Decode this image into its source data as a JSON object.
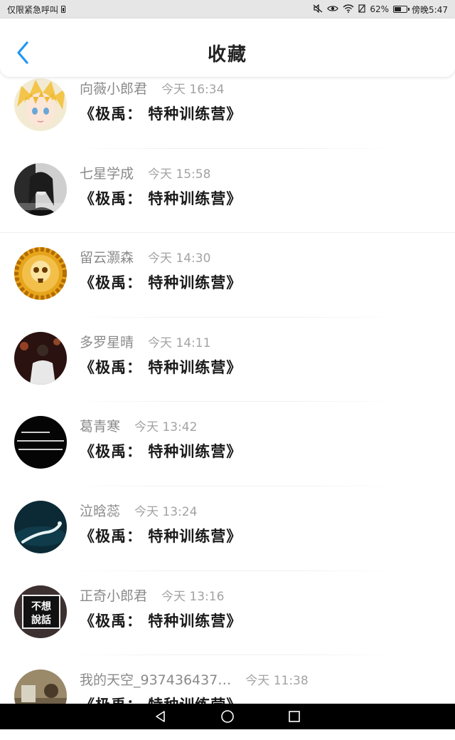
{
  "status_bar": {
    "carrier": "仅限紧急呼叫",
    "battery_percent": "62%",
    "time": "傍晚5:47",
    "battery_level": 0.62
  },
  "header": {
    "title": "收藏",
    "back_icon": "chevron-left-icon",
    "accent_color": "#2196f3"
  },
  "favorites": [
    {
      "user": "向薇小郎君",
      "time": "今天 16:34",
      "title": "《极禹： 特种训练营》",
      "avatar": "anime-blonde"
    },
    {
      "user": "七星学成",
      "time": "今天 15:58",
      "title": "《极禹： 特种训练营》",
      "avatar": "bw-girl"
    },
    {
      "user": "留云灏森",
      "time": "今天 14:30",
      "title": "《极禹： 特种训练营》",
      "avatar": "gold-skull"
    },
    {
      "user": "多罗星晴",
      "time": "今天 14:11",
      "title": "《极禹： 特种训练营》",
      "avatar": "night-person"
    },
    {
      "user": "葛青寒",
      "time": "今天 13:42",
      "title": "《极禹： 特种训练营》",
      "avatar": "black-text"
    },
    {
      "user": "泣晗蕊",
      "time": "今天 13:24",
      "title": "《极禹： 特种训练营》",
      "avatar": "underwater"
    },
    {
      "user": "正奇小郎君",
      "time": "今天 13:16",
      "title": "《极禹： 特种训练营》",
      "avatar": "text-sign"
    },
    {
      "user": "我的天空_937436437…",
      "time": "今天 11:38",
      "title": "《极禹： 特种训练营》",
      "avatar": "outdoor"
    }
  ],
  "avatar_texts": {
    "text_sign": [
      "不想",
      "說話"
    ]
  }
}
